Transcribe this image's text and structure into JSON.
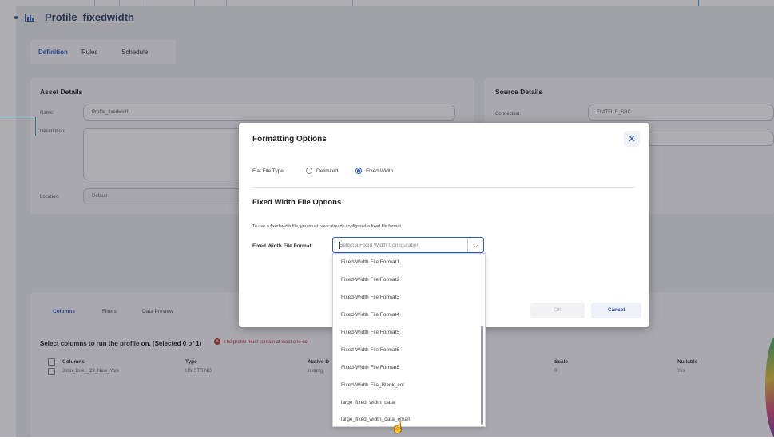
{
  "page": {
    "title": "Profile_fixedwidth",
    "tabs": [
      "Definition",
      "Rules",
      "Schedule"
    ],
    "active_tab": "Definition"
  },
  "asset_details": {
    "heading": "Asset Details",
    "name_label": "Name:",
    "name_value": "Profile_fixedwidth",
    "description_label": "Description:",
    "location_label": "Location:",
    "location_value": "Default"
  },
  "source_details": {
    "heading": "Source Details",
    "connection_label": "Connection:",
    "connection_value": "FLATFILE_SRC"
  },
  "bottom": {
    "tabs": [
      "Columns",
      "Filters",
      "Data Preview"
    ],
    "select_text": "Select columns to run the profile on. (Selected 0 of 1)",
    "error_text": "The profile must contain at least one col",
    "headers": [
      "Columns",
      "Type",
      "Native D",
      "Scale",
      "Nullable"
    ],
    "row": [
      "John_Doe__29_New_York",
      "UNISTRING",
      "nstring",
      "0",
      "Yes"
    ]
  },
  "modal": {
    "title": "Formatting Options",
    "flat_file_type_label": "Flat File Type:",
    "option_delimited": "Delimited",
    "option_fixed": "Fixed Width",
    "subtitle": "Fixed Width File Options",
    "help": "To use a fixed width file, you must have already configured a fixed file format.",
    "fw_label": "Fixed Width File Format:",
    "select_placeholder": "Select a Fixed Width Configuration",
    "ok": "OK",
    "cancel": "Cancel",
    "options": [
      "Fixed-Width File Format1",
      "Fixed-Width File Format2",
      "Fixed-Width File Format3",
      "Fixed-Width File Format4",
      "Fixed-Width File Format5",
      "Fixed-Width File Format6",
      "Fixed-Width File Format8",
      "Fixed-Width File_Blank_col",
      "large_fixed_width_data",
      "large_fixed_width_data_email"
    ]
  },
  "colors": {
    "accent": "#2c5cc5",
    "error": "#c0392b",
    "guide_line": "#2fa9c9"
  }
}
